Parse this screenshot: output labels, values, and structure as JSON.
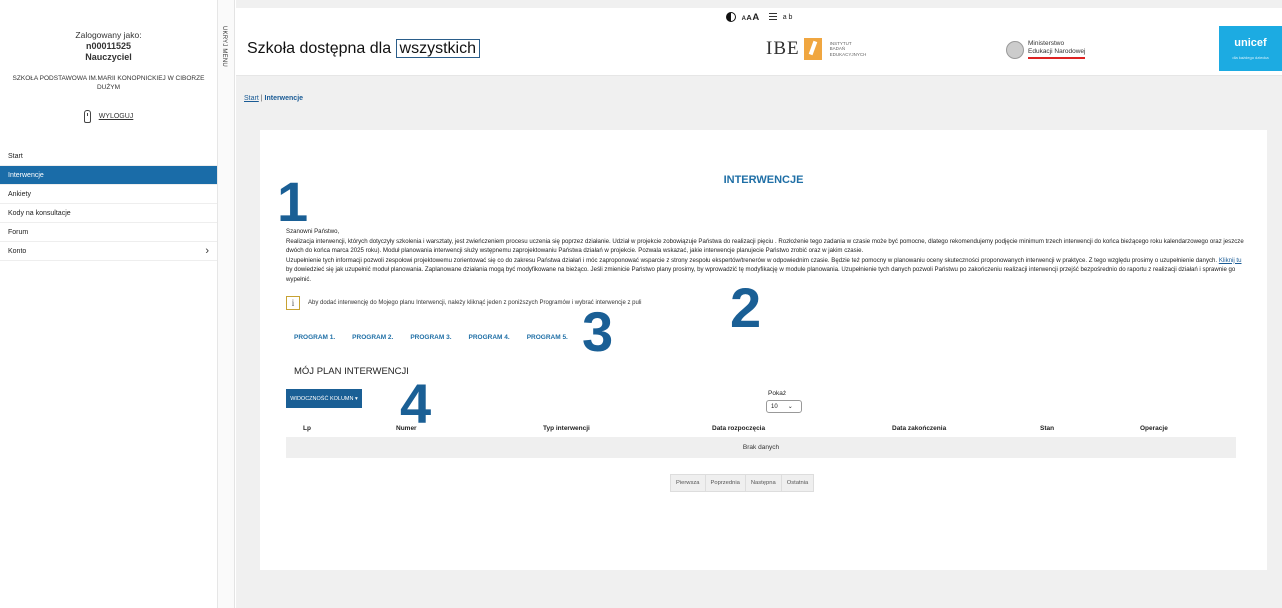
{
  "sidebar": {
    "logged_as_label": "Zalogowany jako:",
    "login": "n00011525",
    "role": "Nauczyciel",
    "school": "SZKOŁA PODSTAWOWA IM.MARII KONOPNICKIEJ W CIBORZE DUŻYM",
    "logout": "WYLOGUJ",
    "items": [
      {
        "label": "Start"
      },
      {
        "label": "Interwencje"
      },
      {
        "label": "Ankiety"
      },
      {
        "label": "Kody na konsultacje"
      },
      {
        "label": "Forum"
      },
      {
        "label": "Konto",
        "chevron": "›"
      }
    ],
    "collapse_label": "UKRYJ MENU"
  },
  "a11y": {
    "font_size": [
      "A",
      "A",
      "A"
    ],
    "letter_icon": "a b"
  },
  "header": {
    "title_prefix": "Szkoła dostępna dla ",
    "title_highlight": "wszystkich",
    "ibe_text": "IBE",
    "ibe_sub": [
      "INSTYTUT",
      "BADAŃ",
      "EDUKACYJNYCH"
    ],
    "men_text": [
      "Ministerstwo",
      "Edukacji Narodowej"
    ],
    "unicef_name": "unicef",
    "unicef_tag": "dla każdego dziecka"
  },
  "breadcrumb": {
    "start": "Start",
    "sep": " | ",
    "current": "Interwencje"
  },
  "content": {
    "heading": "INTERWENCJE",
    "markers": [
      "1",
      "2",
      "3",
      "4"
    ],
    "greeting": "Szanowni Państwo,",
    "paragraph1": "Realizacja interwencji, których dotyczyły szkolenia i warsztaty, jest zwieńczeniem procesu uczenia się poprzez działanie. Udział w projekcie zobowiązuje Państwa do realizacji pięciu . Rozłożenie tego zadania w czasie może być pomocne, dlatego rekomendujemy podjęcie minimum trzech interwencji do końca bieżącego roku kalendarzowego oraz jeszcze dwóch do końca marca 2025 roku). Moduł planowania interwencji służy wstępnemu zaprojektowaniu Państwa działań w projekcie. Pozwala wskazać, jakie interwencje planujecie Państwo zrobić oraz w jakim czasie.",
    "paragraph2_a": "Uzupełnienie tych informacji pozwoli zespołowi projektowemu zorientować się co do zakresu Państwa działań i móc zaproponować wsparcie z strony zespołu ekspertów/trenerów w odpowiednim czasie. Będzie też pomocny w planowaniu oceny skuteczności proponowanych interwencji w praktyce. Z tego względu prosimy o uzupełnienie danych. ",
    "paragraph2_link": "Kliknij tu",
    "paragraph2_b": " by dowiedzieć się jak uzupełnić moduł planowania. Zaplanowane działania mogą być modyfikowane na bieżąco. Jeśli zmienicie Państwo plany prosimy, by wprowadzić tę modyfikację w module planowania. Uzupełnienie tych danych pozwoli Państwu po zakończeniu realizacji interwencji przejść bezpośrednio do raportu z realizacji działań i sprawnie go wypełnić.",
    "info_icon": "i",
    "info_text": "Aby dodać interwencję do Mojego planu Interwencji, należy kliknąć jeden z poniższych Programów i wybrać interwencje z puli",
    "programs": [
      "PROGRAM 1.",
      "PROGRAM 2.",
      "PROGRAM 3.",
      "PROGRAM 4.",
      "PROGRAM 5."
    ],
    "plan_title": "MÓJ PLAN INTERWENCJI",
    "columns_button": "WIDOCZNOŚĆ KOLUMN ▾",
    "show_label": "Pokaż",
    "show_value": "10",
    "table_headers": [
      "Lp",
      "Numer",
      "Typ interwencji",
      "Data rozpoczęcia",
      "Data zakończenia",
      "Stan",
      "Operacje"
    ],
    "empty_text": "Brak danych",
    "pager": [
      "Pierwsza",
      "Poprzednia",
      "Następna",
      "Ostatnia"
    ]
  }
}
